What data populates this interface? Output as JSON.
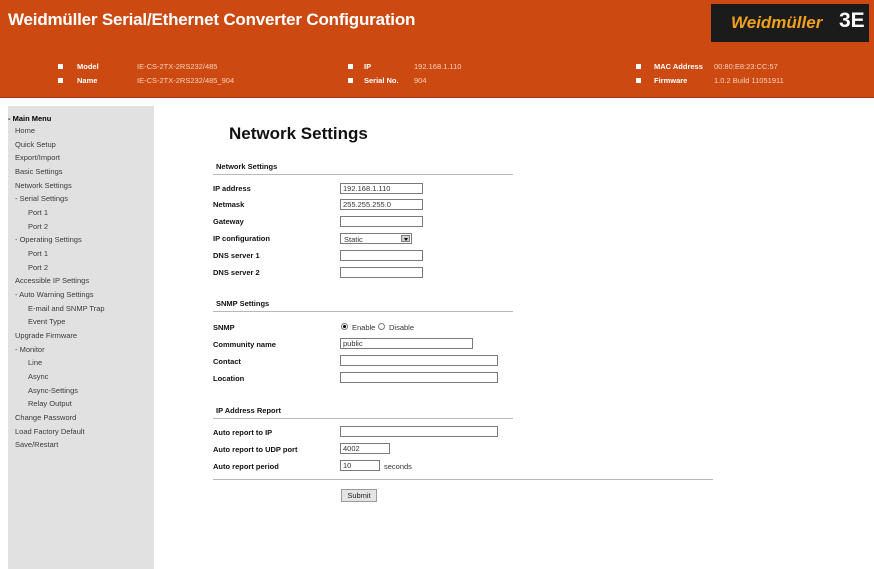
{
  "header": {
    "title": "Weidmüller Serial/Ethernet Converter Configuration",
    "logo_text": "Weidmüller",
    "logo_mark": "3E",
    "info": {
      "model_label": "Model",
      "model_value": "IE-CS-2TX-2RS232/485",
      "name_label": "Name",
      "name_value": "IE-CS-2TX-2RS232/485_904",
      "ip_label": "IP",
      "ip_value": "192.168.1.110",
      "serial_label": "Serial No.",
      "serial_value": "904",
      "mac_label": "MAC Address",
      "mac_value": "00:80:E8:23:CC:57",
      "firmware_label": "Firmware",
      "firmware_value": "1.0.2 Build 11051911"
    }
  },
  "sidebar": {
    "items": [
      {
        "label": "- Main Menu",
        "head": true
      },
      {
        "label": "Home"
      },
      {
        "label": "Quick Setup"
      },
      {
        "label": "Export/Import"
      },
      {
        "label": "Basic Settings"
      },
      {
        "label": "Network Settings"
      },
      {
        "label": "- Serial Settings"
      },
      {
        "label": "Port 1"
      },
      {
        "label": "Port 2"
      },
      {
        "label": "- Operating Settings"
      },
      {
        "label": "Port 1"
      },
      {
        "label": "Port 2"
      },
      {
        "label": "Accessible IP Settings"
      },
      {
        "label": "- Auto Warning Settings"
      },
      {
        "label": "E-mail and SNMP Trap"
      },
      {
        "label": "Event Type"
      },
      {
        "label": "Upgrade Firmware"
      },
      {
        "label": "- Monitor"
      },
      {
        "label": "Line"
      },
      {
        "label": "Async"
      },
      {
        "label": "Async-Settings"
      },
      {
        "label": "Relay Output"
      },
      {
        "label": "Change Password"
      },
      {
        "label": "Load Factory Default"
      },
      {
        "label": "Save/Restart"
      }
    ]
  },
  "main": {
    "title": "Network Settings",
    "network": {
      "section_title": "Network Settings",
      "ip_label": "IP address",
      "ip_value": "192.168.1.110",
      "netmask_label": "Netmask",
      "netmask_value": "255.255.255.0",
      "gateway_label": "Gateway",
      "gateway_value": "",
      "ipconfig_label": "IP configuration",
      "ipconfig_value": "Static",
      "dns1_label": "DNS server 1",
      "dns1_value": "",
      "dns2_label": "DNS server 2",
      "dns2_value": ""
    },
    "snmp": {
      "section_title": "SNMP Settings",
      "snmp_label": "SNMP",
      "enable_label": "Enable",
      "disable_label": "Disable",
      "selected": "enable",
      "community_label": "Community name",
      "community_value": "public",
      "contact_label": "Contact",
      "contact_value": "",
      "location_label": "Location",
      "location_value": ""
    },
    "report": {
      "section_title": "IP Address Report",
      "auto_ip_label": "Auto report to IP",
      "auto_ip_value": "",
      "udp_label": "Auto report to UDP port",
      "udp_value": "4002",
      "period_label": "Auto report period",
      "period_value": "10",
      "period_unit": "seconds"
    },
    "submit_label": "Submit"
  }
}
